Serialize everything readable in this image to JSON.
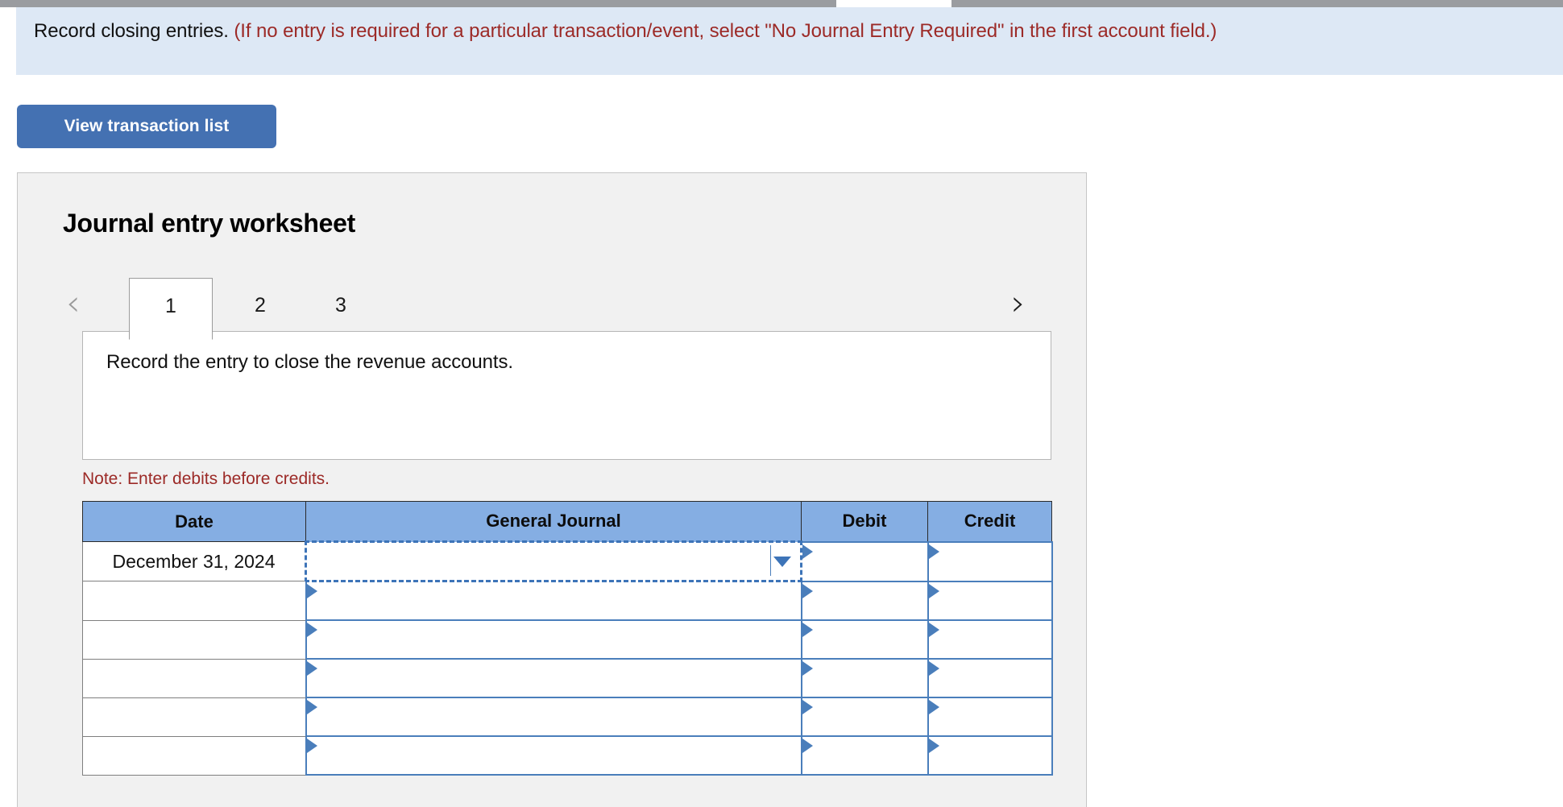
{
  "banner": {
    "heading": "Record closing entries.",
    "instruction": "(If no entry is required for a particular transaction/event, select \"No Journal Entry Required\" in the first account field.)"
  },
  "toolbar": {
    "view_transaction_list_label": "View transaction list"
  },
  "worksheet": {
    "title": "Journal entry worksheet",
    "prev_arrow": "‹",
    "next_arrow": "›",
    "tabs": [
      {
        "label": "1",
        "active": true
      },
      {
        "label": "2",
        "active": false
      },
      {
        "label": "3",
        "active": false
      }
    ],
    "description": "Record the entry to close the revenue accounts.",
    "note": "Note: Enter debits before credits."
  },
  "journal_table": {
    "columns": [
      "Date",
      "General Journal",
      "Debit",
      "Credit"
    ],
    "rows": [
      {
        "date": "December 31, 2024",
        "general_journal": "",
        "debit": "",
        "credit": "",
        "focused": true
      },
      {
        "date": "",
        "general_journal": "",
        "debit": "",
        "credit": "",
        "focused": false
      },
      {
        "date": "",
        "general_journal": "",
        "debit": "",
        "credit": "",
        "focused": false
      },
      {
        "date": "",
        "general_journal": "",
        "debit": "",
        "credit": "",
        "focused": false
      },
      {
        "date": "",
        "general_journal": "",
        "debit": "",
        "credit": "",
        "focused": false
      },
      {
        "date": "",
        "general_journal": "",
        "debit": "",
        "credit": "",
        "focused": false
      }
    ]
  },
  "colors": {
    "banner_bg": "#dde8f5",
    "note_red": "#9c2a27",
    "button_blue": "#4471b2",
    "header_blue": "#85aee3",
    "cell_border_blue": "#4a7ebb",
    "panel_bg": "#f1f1f1"
  }
}
